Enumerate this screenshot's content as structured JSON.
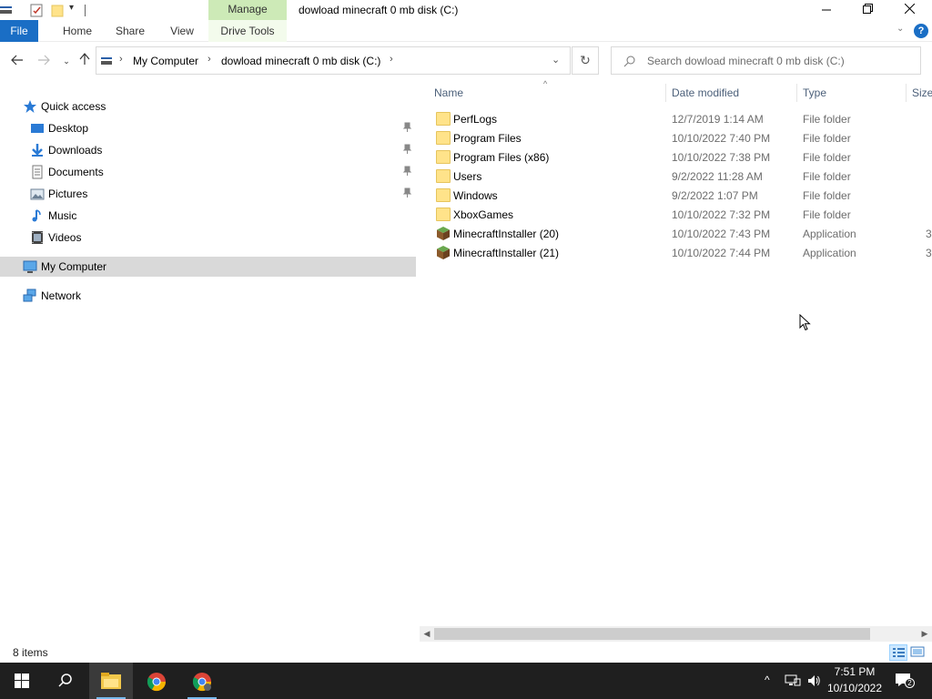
{
  "window": {
    "title": "dowload minecraft 0 mb disk (C:)",
    "contextual_tab": "Manage",
    "contextual_group": "Drive Tools"
  },
  "ribbon": {
    "tabs": [
      "File",
      "Home",
      "Share",
      "View",
      "Drive Tools"
    ]
  },
  "address": {
    "crumbs": [
      "My Computer",
      "dowload minecraft 0 mb disk (C:)"
    ],
    "search_placeholder": "Search dowload minecraft 0 mb disk (C:)"
  },
  "nav": {
    "quick_access": "Quick access",
    "items": [
      {
        "label": "Desktop",
        "pinned": true,
        "icon": "desktop-icon"
      },
      {
        "label": "Downloads",
        "pinned": true,
        "icon": "downloads-icon"
      },
      {
        "label": "Documents",
        "pinned": true,
        "icon": "documents-icon"
      },
      {
        "label": "Pictures",
        "pinned": true,
        "icon": "pictures-icon"
      },
      {
        "label": "Music",
        "pinned": false,
        "icon": "music-icon"
      },
      {
        "label": "Videos",
        "pinned": false,
        "icon": "videos-icon"
      }
    ],
    "my_computer": "My Computer",
    "network": "Network"
  },
  "columns": [
    "Name",
    "Date modified",
    "Type",
    "Size"
  ],
  "files": [
    {
      "name": "PerfLogs",
      "date": "12/7/2019 1:14 AM",
      "type": "File folder",
      "size": "",
      "icon": "folder-icon"
    },
    {
      "name": "Program Files",
      "date": "10/10/2022 7:40 PM",
      "type": "File folder",
      "size": "",
      "icon": "folder-icon"
    },
    {
      "name": "Program Files (x86)",
      "date": "10/10/2022 7:38 PM",
      "type": "File folder",
      "size": "",
      "icon": "folder-icon"
    },
    {
      "name": "Users",
      "date": "9/2/2022 11:28 AM",
      "type": "File folder",
      "size": "",
      "icon": "folder-icon"
    },
    {
      "name": "Windows",
      "date": "9/2/2022 1:07 PM",
      "type": "File folder",
      "size": "",
      "icon": "folder-icon"
    },
    {
      "name": "XboxGames",
      "date": "10/10/2022 7:32 PM",
      "type": "File folder",
      "size": "",
      "icon": "folder-icon"
    },
    {
      "name": "MinecraftInstaller (20)",
      "date": "10/10/2022 7:43 PM",
      "type": "Application",
      "size": "3",
      "icon": "minecraft-grass-block-icon"
    },
    {
      "name": "MinecraftInstaller (21)",
      "date": "10/10/2022 7:44 PM",
      "type": "Application",
      "size": "3",
      "icon": "minecraft-grass-block-icon"
    }
  ],
  "status": {
    "item_count": "8 items"
  },
  "taskbar": {
    "time": "7:51 PM",
    "date": "10/10/2022",
    "notification_count": "2"
  },
  "colors": {
    "file_tab": "#1a6ec5",
    "manage_tab": "#cdeab7",
    "selected_nav": "#d9d9d9",
    "taskbar": "#1f1f1f"
  }
}
